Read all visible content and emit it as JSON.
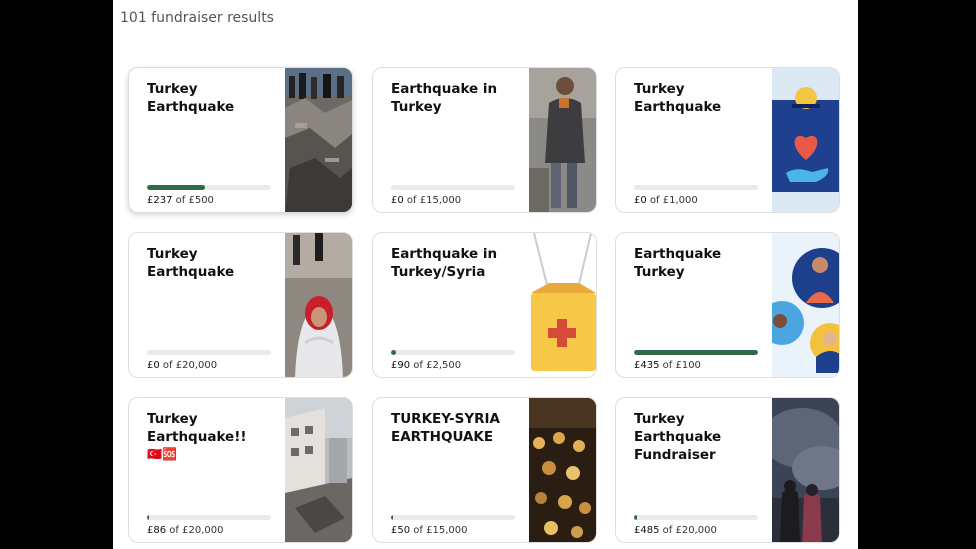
{
  "results_label": "101 fundraiser results",
  "colors": {
    "progress": "#2f6b4a",
    "track": "#ebebe6"
  },
  "cards": [
    {
      "title": "Turkey Earthquake",
      "emoji": "",
      "raised": "£237",
      "of": "of",
      "goal": "£500",
      "progress": 0.47,
      "image": "rubble-crowd-photo"
    },
    {
      "title": "Earthquake in Turkey",
      "emoji": "",
      "raised": "£0",
      "of": "of",
      "goal": "£15,000",
      "progress": 0,
      "image": "man-in-rubble-photo"
    },
    {
      "title": "Turkey Earthquake",
      "emoji": "",
      "raised": "£0",
      "of": "of",
      "goal": "£1,000",
      "progress": 0,
      "image": "donation-heart-illustration"
    },
    {
      "title": "Turkey Earthquake",
      "emoji": "",
      "raised": "£0",
      "of": "of",
      "goal": "£20,000",
      "progress": 0,
      "image": "child-in-blanket-photo"
    },
    {
      "title": "Earthquake in Turkey/Syria",
      "emoji": "",
      "raised": "£90",
      "of": "of",
      "goal": "£2,500",
      "progress": 0.04,
      "image": "first-aid-kit-illustration"
    },
    {
      "title": "Earthquake Turkey",
      "emoji": "",
      "raised": "£435",
      "of": "of",
      "goal": "£100",
      "progress": 1,
      "image": "community-illustration"
    },
    {
      "title": "Turkey Earthquake!!",
      "emoji": "🇹🇷🆘",
      "raised": "£86",
      "of": "of",
      "goal": "£20,000",
      "progress": 0.004,
      "image": "collapsed-building-photo"
    },
    {
      "title": "TURKEY-SYRIA EARTHQUAKE",
      "emoji": "",
      "raised": "£50",
      "of": "of",
      "goal": "£15,000",
      "progress": 0.003,
      "image": "night-rescue-photo"
    },
    {
      "title": "Turkey Earthquake Fundraiser",
      "emoji": "",
      "raised": "£485",
      "of": "of",
      "goal": "£20,000",
      "progress": 0.024,
      "image": "people-under-smoke-photo"
    }
  ]
}
